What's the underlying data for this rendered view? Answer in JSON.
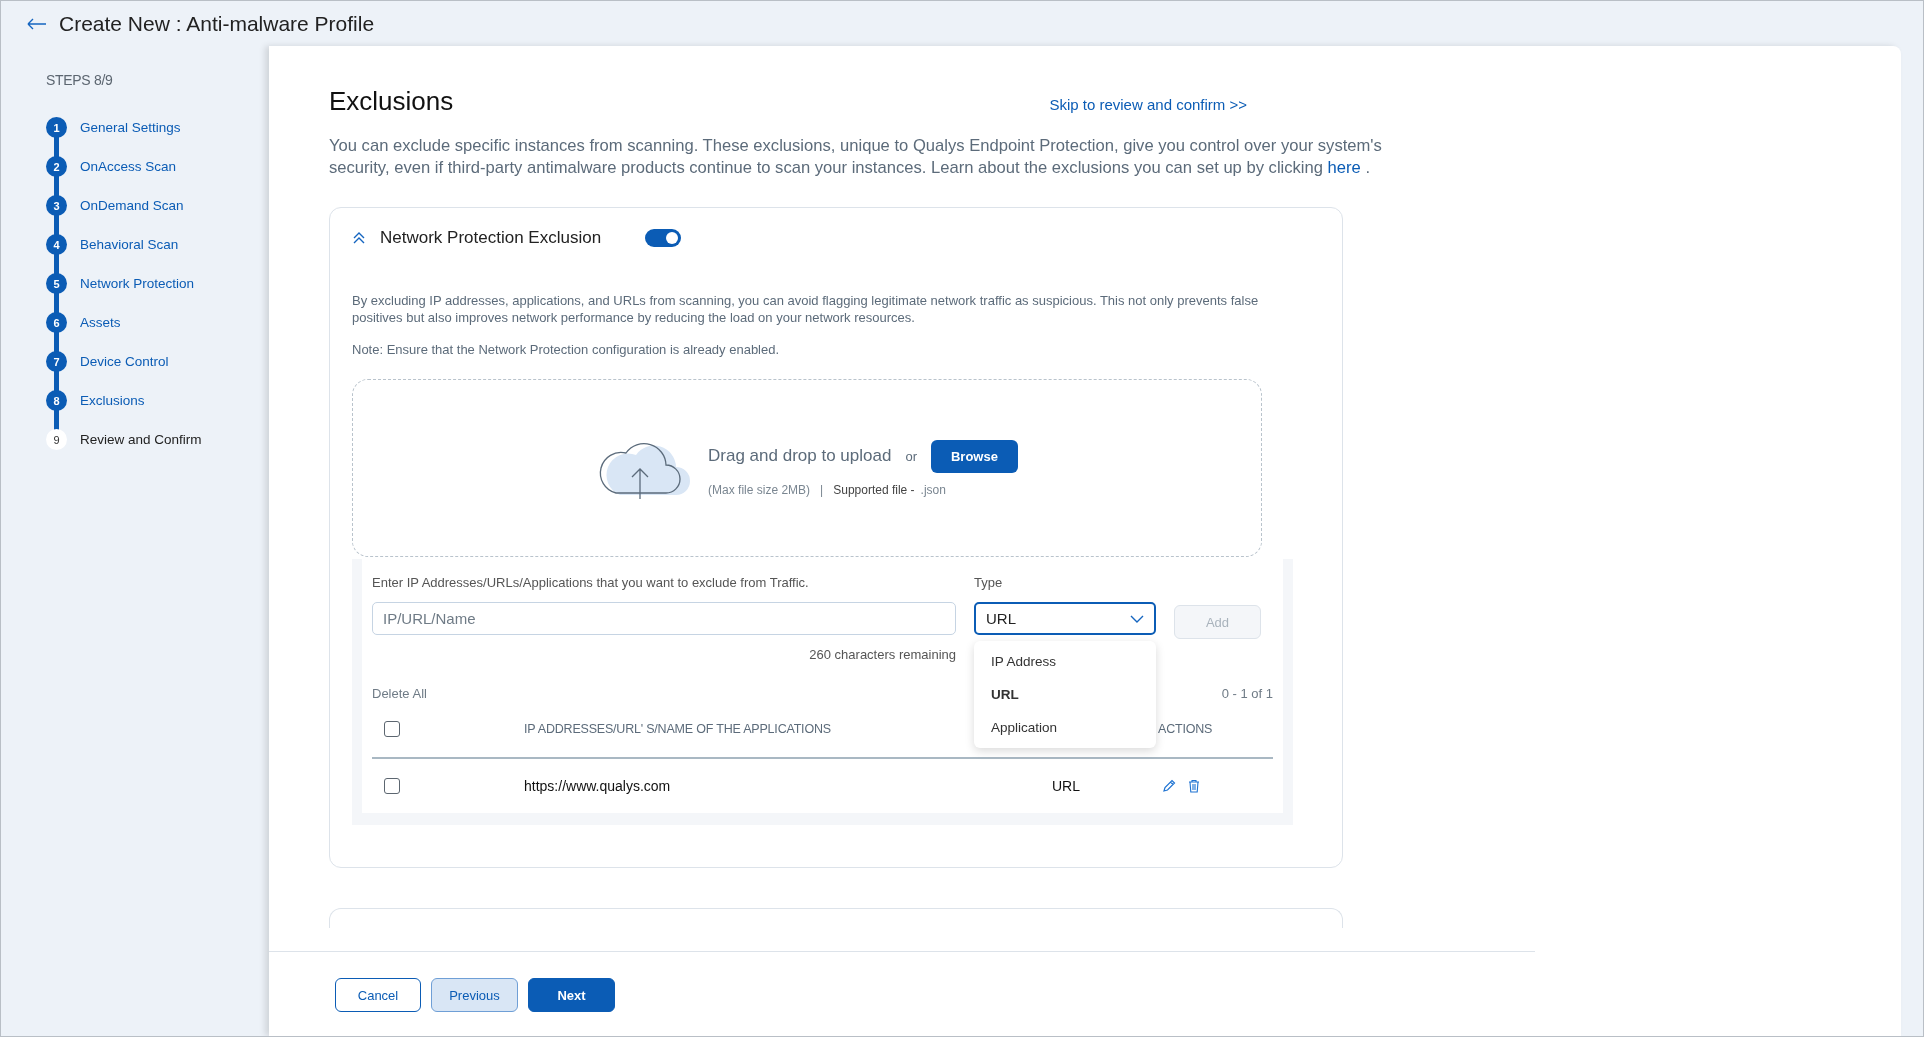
{
  "header": {
    "title": "Create New : Anti-malware Profile"
  },
  "sidebar": {
    "progress": "STEPS 8/9",
    "steps": [
      {
        "number": "1",
        "label": "General Settings",
        "completed": true
      },
      {
        "number": "2",
        "label": "OnAccess Scan",
        "completed": true
      },
      {
        "number": "3",
        "label": "OnDemand Scan",
        "completed": true
      },
      {
        "number": "4",
        "label": "Behavioral Scan",
        "completed": true
      },
      {
        "number": "5",
        "label": "Network Protection",
        "completed": true
      },
      {
        "number": "6",
        "label": "Assets",
        "completed": true
      },
      {
        "number": "7",
        "label": "Device Control",
        "completed": true
      },
      {
        "number": "8",
        "label": "Exclusions",
        "completed": true
      },
      {
        "number": "9",
        "label": "Review and Confirm",
        "completed": false
      }
    ]
  },
  "page": {
    "title": "Exclusions",
    "skip_link": "Skip to review and confirm >>",
    "intro": "You can exclude specific instances from scanning. These exclusions, unique to Qualys Endpoint Protection, give you control over your system's security, even if third-party antimalware products continue to scan your instances. Learn about the exclusions you can set up by clicking",
    "intro_link": "here",
    "intro_end": "."
  },
  "section": {
    "title": "Network Protection Exclusion",
    "expanded": true,
    "enabled": true,
    "description": "By excluding IP addresses, applications, and URLs from scanning, you can avoid flagging legitimate network traffic as suspicious. This not only prevents false positives but also improves network performance by reducing the load on your network resources.",
    "note": "Note: Ensure that the Network Protection configuration is already enabled.",
    "upload": {
      "prompt": "Drag and drop to upload",
      "or": "or",
      "button": "Browse",
      "size_hint": "(Max file size 2MB)",
      "separator": "|",
      "supported_label": "Supported file -",
      "supported_value": ".json"
    },
    "entry": {
      "label": "Enter IP Addresses/URLs/Applications that you want to exclude from Traffic.",
      "placeholder": "IP/URL/Name",
      "counter": "260 characters remaining",
      "type_label": "Type",
      "type_value": "URL",
      "add_button": "Add",
      "add_disabled": true,
      "type_options": [
        {
          "label": "IP Address",
          "selected": false
        },
        {
          "label": "URL",
          "selected": true
        },
        {
          "label": "Application",
          "selected": false
        }
      ]
    },
    "table": {
      "delete_all": "Delete All",
      "pagination": "0 - 1 of 1",
      "header_checked": false,
      "value_column": "IP ADDRESSES/URL' S/NAME OF THE APPLICATIONS",
      "actions_column": "ACTIONS",
      "rows": [
        {
          "checked": false,
          "value": "https://www.qualys.com",
          "type": "URL"
        }
      ]
    }
  },
  "footer": {
    "buttons": [
      {
        "label": "Cancel",
        "kind": "secondary"
      },
      {
        "label": "Previous",
        "kind": "tertiary"
      },
      {
        "label": "Next",
        "kind": "primary"
      }
    ]
  }
}
